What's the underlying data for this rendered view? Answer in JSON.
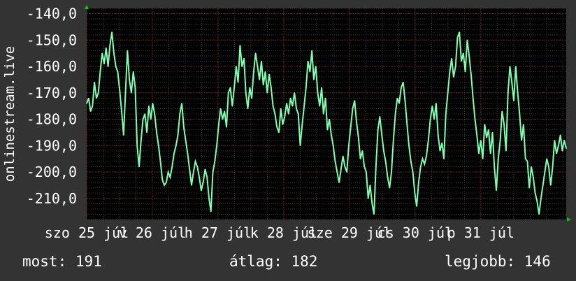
{
  "chart_data": {
    "type": "line",
    "ylabel": "onlinestream.live",
    "ylim": [
      -218,
      -138
    ],
    "y_ticks": [
      "-140,0",
      "-150,0",
      "-160,0",
      "-170,0",
      "-180,0",
      "-190,0",
      "-200,0",
      "-210,0"
    ],
    "y_tick_values": [
      -140,
      -150,
      -160,
      -170,
      -180,
      -190,
      -200,
      -210
    ],
    "x_tick_labels": [
      "szo 25 júl",
      "v 26 júl",
      "h 27 júl",
      "k 28 júl",
      "sze 29 júl",
      "cs 30 júl",
      "p 31 júl"
    ],
    "x_tick_positions": [
      0,
      1,
      2,
      3,
      4,
      5,
      6
    ],
    "xlim": [
      0,
      7.3
    ],
    "grid": true,
    "colors": {
      "background": "#333333",
      "plot_background": "#000000",
      "grid_minor": "#3a3a3a",
      "grid_major": "#6b2020",
      "line": "#7fffb0",
      "axis_arrow": "#00cc00",
      "text": "#ffffff"
    },
    "series": [
      {
        "values": [
          -174,
          -172,
          -177,
          -175,
          -166,
          -172,
          -170,
          -162,
          -155,
          -159,
          -153,
          -160,
          -152,
          -147,
          -155,
          -160,
          -162,
          -169,
          -177,
          -186,
          -170,
          -154,
          -165,
          -170,
          -162,
          -168,
          -190,
          -198,
          -188,
          -180,
          -178,
          -185,
          -175,
          -180,
          -174,
          -178,
          -185,
          -190,
          -196,
          -203,
          -205,
          -204,
          -200,
          -202,
          -198,
          -193,
          -190,
          -186,
          -178,
          -174,
          -183,
          -188,
          -193,
          -199,
          -205,
          -200,
          -196,
          -198,
          -202,
          -207,
          -204,
          -199,
          -202,
          -210,
          -215,
          -200,
          -196,
          -190,
          -182,
          -176,
          -180,
          -177,
          -183,
          -170,
          -168,
          -175,
          -168,
          -160,
          -166,
          -152,
          -160,
          -157,
          -170,
          -176,
          -168,
          -172,
          -162,
          -155,
          -160,
          -165,
          -158,
          -167,
          -162,
          -170,
          -163,
          -168,
          -175,
          -178,
          -183,
          -185,
          -176,
          -182,
          -179,
          -174,
          -178,
          -172,
          -175,
          -170,
          -176,
          -178,
          -190,
          -182,
          -175,
          -168,
          -158,
          -162,
          -154,
          -165,
          -160,
          -170,
          -175,
          -168,
          -178,
          -172,
          -184,
          -180,
          -186,
          -190,
          -196,
          -200,
          -204,
          -199,
          -194,
          -198,
          -200,
          -190,
          -183,
          -176,
          -173,
          -181,
          -187,
          -195,
          -192,
          -198,
          -200,
          -210,
          -205,
          -212,
          -216,
          -198,
          -184,
          -179,
          -186,
          -192,
          -196,
          -202,
          -206,
          -200,
          -188,
          -178,
          -172,
          -174,
          -168,
          -166,
          -173,
          -182,
          -190,
          -196,
          -200,
          -208,
          -213,
          -204,
          -198,
          -195,
          -197,
          -194,
          -188,
          -180,
          -175,
          -180,
          -174,
          -186,
          -192,
          -189,
          -195,
          -178,
          -170,
          -162,
          -157,
          -164,
          -160,
          -149,
          -147,
          -158,
          -155,
          -162,
          -150,
          -156,
          -163,
          -172,
          -180,
          -186,
          -193,
          -188,
          -195,
          -182,
          -187,
          -184,
          -193,
          -185,
          -198,
          -207,
          -195,
          -188,
          -177,
          -182,
          -192,
          -170,
          -160,
          -166,
          -173,
          -160,
          -170,
          -178,
          -188,
          -182,
          -195,
          -196,
          -206,
          -198,
          -202,
          -208,
          -211,
          -216,
          -210,
          -205,
          -200,
          -195,
          -198,
          -205,
          -198,
          -188,
          -193,
          -190,
          -186,
          -192,
          -188,
          -191
        ]
      }
    ]
  },
  "stats": {
    "current": "most: 191",
    "average": "átlag: 182",
    "best": "legjobb: 146"
  }
}
